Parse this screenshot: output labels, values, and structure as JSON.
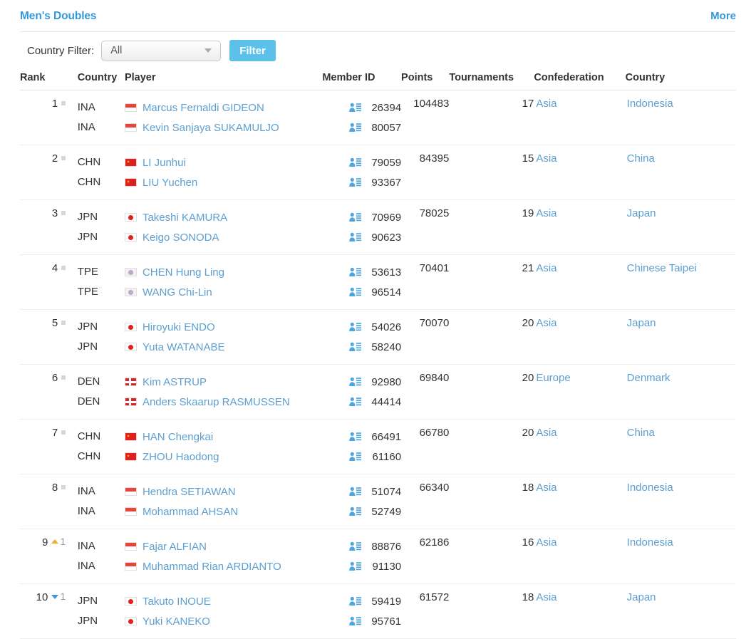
{
  "header": {
    "category_title": "Men's Doubles",
    "more_label": "More"
  },
  "filter": {
    "label": "Country Filter:",
    "selected": "All",
    "button_label": "Filter"
  },
  "table": {
    "columns": {
      "rank": "Rank",
      "country_code": "Country",
      "player": "Player",
      "member_id": "Member ID",
      "points": "Points",
      "tournaments": "Tournaments",
      "confederation": "Confederation",
      "country": "Country"
    },
    "rows": [
      {
        "rank": "1",
        "movement": "flat",
        "movement_count": "",
        "points": "104483",
        "tournaments": "17",
        "confederation": "Asia",
        "country": "Indonesia",
        "players": [
          {
            "code": "INA",
            "flag": "ina",
            "name": "Marcus Fernaldi GIDEON",
            "member_id": "26394"
          },
          {
            "code": "INA",
            "flag": "ina",
            "name": "Kevin Sanjaya SUKAMULJO",
            "member_id": "80057"
          }
        ]
      },
      {
        "rank": "2",
        "movement": "flat",
        "movement_count": "",
        "points": "84395",
        "tournaments": "15",
        "confederation": "Asia",
        "country": "China",
        "players": [
          {
            "code": "CHN",
            "flag": "chn",
            "name": "LI Junhui",
            "member_id": "79059"
          },
          {
            "code": "CHN",
            "flag": "chn",
            "name": "LIU Yuchen",
            "member_id": "93367"
          }
        ]
      },
      {
        "rank": "3",
        "movement": "flat",
        "movement_count": "",
        "points": "78025",
        "tournaments": "19",
        "confederation": "Asia",
        "country": "Japan",
        "players": [
          {
            "code": "JPN",
            "flag": "jpn",
            "name": "Takeshi KAMURA",
            "member_id": "70969"
          },
          {
            "code": "JPN",
            "flag": "jpn",
            "name": "Keigo SONODA",
            "member_id": "90623"
          }
        ]
      },
      {
        "rank": "4",
        "movement": "flat",
        "movement_count": "",
        "points": "70401",
        "tournaments": "21",
        "confederation": "Asia",
        "country": "Chinese Taipei",
        "players": [
          {
            "code": "TPE",
            "flag": "tpe",
            "name": "CHEN Hung Ling",
            "member_id": "53613"
          },
          {
            "code": "TPE",
            "flag": "tpe",
            "name": "WANG Chi-Lin",
            "member_id": "96514"
          }
        ]
      },
      {
        "rank": "5",
        "movement": "flat",
        "movement_count": "",
        "points": "70070",
        "tournaments": "20",
        "confederation": "Asia",
        "country": "Japan",
        "players": [
          {
            "code": "JPN",
            "flag": "jpn",
            "name": "Hiroyuki ENDO",
            "member_id": "54026"
          },
          {
            "code": "JPN",
            "flag": "jpn",
            "name": "Yuta WATANABE",
            "member_id": "58240"
          }
        ]
      },
      {
        "rank": "6",
        "movement": "flat",
        "movement_count": "",
        "points": "69840",
        "tournaments": "20",
        "confederation": "Europe",
        "country": "Denmark",
        "players": [
          {
            "code": "DEN",
            "flag": "den",
            "name": "Kim ASTRUP",
            "member_id": "92980"
          },
          {
            "code": "DEN",
            "flag": "den",
            "name": "Anders Skaarup RASMUSSEN",
            "member_id": "44414"
          }
        ]
      },
      {
        "rank": "7",
        "movement": "flat",
        "movement_count": "",
        "points": "66780",
        "tournaments": "20",
        "confederation": "Asia",
        "country": "China",
        "players": [
          {
            "code": "CHN",
            "flag": "chn",
            "name": "HAN Chengkai",
            "member_id": "66491"
          },
          {
            "code": "CHN",
            "flag": "chn",
            "name": "ZHOU Haodong",
            "member_id": "61160"
          }
        ]
      },
      {
        "rank": "8",
        "movement": "flat",
        "movement_count": "",
        "points": "66340",
        "tournaments": "18",
        "confederation": "Asia",
        "country": "Indonesia",
        "players": [
          {
            "code": "INA",
            "flag": "ina",
            "name": "Hendra SETIAWAN",
            "member_id": "51074"
          },
          {
            "code": "INA",
            "flag": "ina",
            "name": "Mohammad AHSAN",
            "member_id": "52749"
          }
        ]
      },
      {
        "rank": "9",
        "movement": "up",
        "movement_count": "1",
        "points": "62186",
        "tournaments": "16",
        "confederation": "Asia",
        "country": "Indonesia",
        "players": [
          {
            "code": "INA",
            "flag": "ina",
            "name": "Fajar ALFIAN",
            "member_id": "88876"
          },
          {
            "code": "INA",
            "flag": "ina",
            "name": "Muhammad Rian ARDIANTO",
            "member_id": "91130"
          }
        ]
      },
      {
        "rank": "10",
        "movement": "down",
        "movement_count": "1",
        "points": "61572",
        "tournaments": "18",
        "confederation": "Asia",
        "country": "Japan",
        "players": [
          {
            "code": "JPN",
            "flag": "jpn",
            "name": "Takuto INOUE",
            "member_id": "59419"
          },
          {
            "code": "JPN",
            "flag": "jpn",
            "name": "Yuki KANEKO",
            "member_id": "95761"
          }
        ]
      }
    ]
  },
  "colors": {
    "accent": "#3498db",
    "link": "#5d9fd0",
    "button": "#5bc0ea",
    "movement_up": "#f0ad2e",
    "movement_down": "#3a9ad9",
    "movement_flat": "#d6d6d6"
  },
  "icons": {
    "member_id": "contact-card-icon",
    "dropdown": "chevron-down-icon"
  }
}
